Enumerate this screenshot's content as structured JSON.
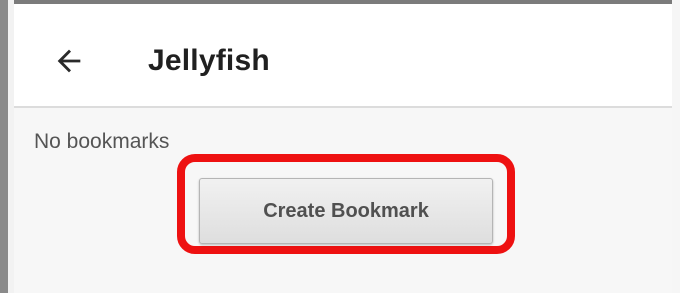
{
  "app_bar": {
    "title": "Jellyfish",
    "back_icon": "arrow-left-icon"
  },
  "bookmarks": {
    "empty_message": "No bookmarks",
    "create_button_label": "Create Bookmark"
  },
  "colors": {
    "highlight": "#ee1111",
    "title_text": "#202020",
    "body_text": "#555555",
    "content_bg": "#f7f7f7"
  }
}
